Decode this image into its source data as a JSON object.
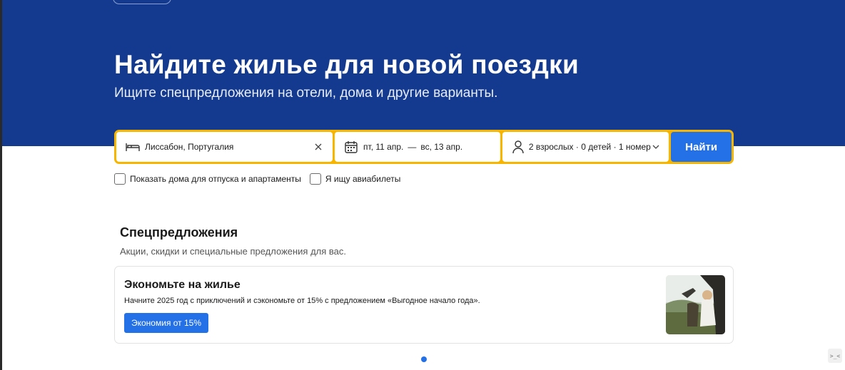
{
  "hero": {
    "title": "Найдите жилье для новой поездки",
    "subtitle": "Ищите спецпредложения на отели, дома и другие варианты."
  },
  "search": {
    "destination": "Лиссабон, Португалия",
    "date_start": "пт, 11 апр.",
    "date_separator": "—",
    "date_end": "вс, 13 апр.",
    "guests": "2 взрослых · 0 детей · 1 номер",
    "button_label": "Найти"
  },
  "options": {
    "homes_label": "Показать дома для отпуска и апартаменты",
    "flights_label": "Я ищу авиабилеты"
  },
  "deals": {
    "title": "Спецпредложения",
    "subtitle": "Акции, скидки и специальные предложения для вас.",
    "card": {
      "title": "Экономьте на жилье",
      "text": "Начните 2025 год с приключений и сэкономьте от 15% с предложением «Выгодное начало года».",
      "button_label": "Экономия от 15%"
    }
  },
  "widget_glyph": ">_<",
  "colors": {
    "hero_bg": "#143a8f",
    "search_border": "#f7b500",
    "primary_button": "#2470e6"
  },
  "icons": [
    "bed-icon",
    "close-icon",
    "calendar-icon",
    "person-icon",
    "chevron-down-icon"
  ]
}
